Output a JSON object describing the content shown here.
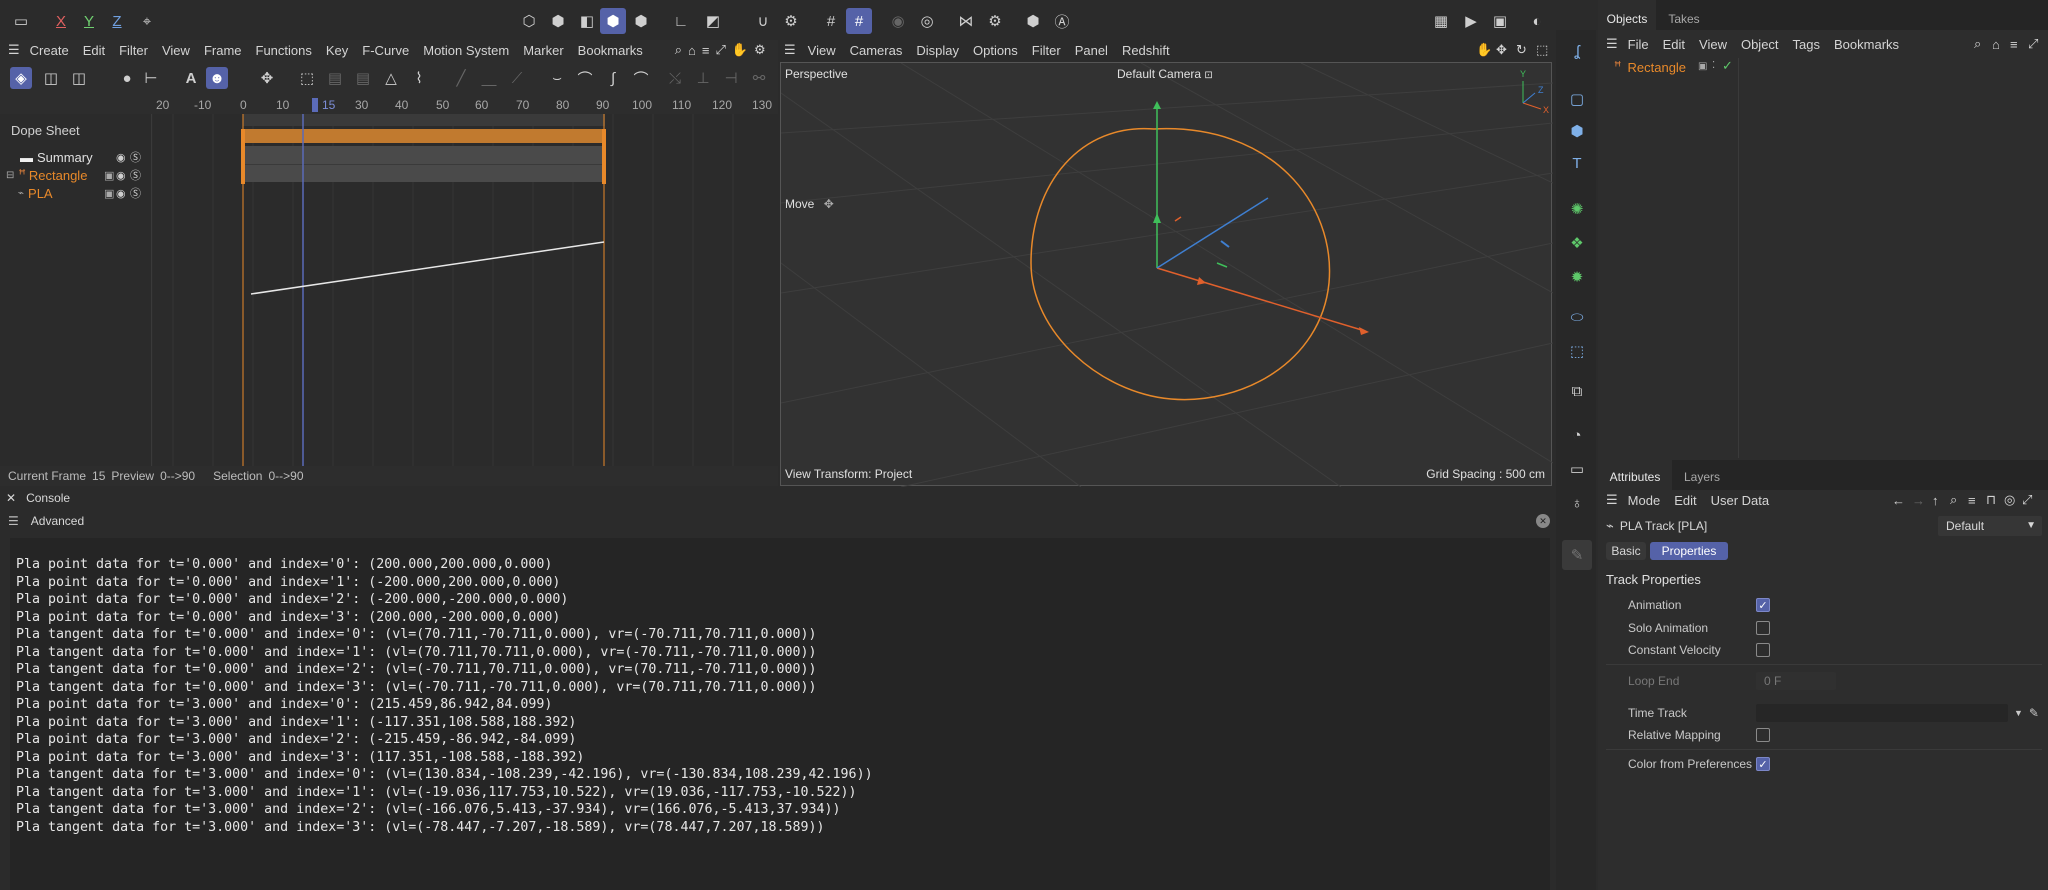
{
  "toolbar": {
    "axis_x": "X",
    "axis_y": "Y",
    "axis_z": "Z"
  },
  "timeline": {
    "menu": [
      "Create",
      "Edit",
      "Filter",
      "View",
      "Frame",
      "Functions",
      "Key",
      "F-Curve",
      "Motion System",
      "Marker",
      "Bookmarks"
    ],
    "ruler": [
      "20",
      "-10",
      "0",
      "10",
      "15",
      "30",
      "40",
      "50",
      "60",
      "70",
      "80",
      "90",
      "100",
      "110",
      "120",
      "130"
    ],
    "panel_title": "Dope Sheet",
    "tracks": [
      {
        "label": "Summary"
      },
      {
        "label": "Rectangle"
      },
      {
        "label": "PLA"
      }
    ],
    "status": {
      "current_frame_label": "Current Frame",
      "current_frame_value": "15",
      "preview_label": "Preview",
      "preview_value": "0-->90",
      "selection_label": "Selection",
      "selection_value": "0-->90"
    }
  },
  "viewport": {
    "menu": [
      "View",
      "Cameras",
      "Display",
      "Options",
      "Filter",
      "Panel",
      "Redshift"
    ],
    "view_name": "Perspective",
    "camera": "Default Camera",
    "tool": "Move",
    "view_transform": "View Transform: Project",
    "grid_spacing": "Grid Spacing : 500 cm",
    "colors": {
      "spline": "#e8892a",
      "axis_x": "#e0602c",
      "axis_y": "#3fbf5a",
      "axis_z": "#3f7fd0"
    }
  },
  "objects_panel": {
    "tabs": [
      "Objects",
      "Takes"
    ],
    "menu": [
      "File",
      "Edit",
      "View",
      "Object",
      "Tags",
      "Bookmarks"
    ],
    "items": [
      {
        "name": "Rectangle"
      }
    ]
  },
  "attributes_panel": {
    "tabs": [
      "Attributes",
      "Layers"
    ],
    "menu": [
      "Mode",
      "Edit",
      "User Data"
    ],
    "title": "PLA Track [PLA]",
    "preset": "Default",
    "subtabs": [
      "Basic",
      "Properties"
    ],
    "section": "Track Properties",
    "props": {
      "animation": {
        "label": "Animation",
        "checked": true
      },
      "solo_animation": {
        "label": "Solo Animation",
        "checked": false
      },
      "constant_velocity": {
        "label": "Constant Velocity",
        "checked": false
      },
      "loop_end": {
        "label": "Loop End",
        "value": "0 F"
      },
      "time_track": {
        "label": "Time Track",
        "value": ""
      },
      "relative_mapping": {
        "label": "Relative Mapping",
        "checked": false
      },
      "color_from_prefs": {
        "label": "Color from Preferences",
        "checked": true
      }
    }
  },
  "console": {
    "title": "Console",
    "subtitle": "Advanced",
    "lines": [
      "Pla point data for t='0.000' and index='0': (200.000,200.000,0.000)",
      "Pla point data for t='0.000' and index='1': (-200.000,200.000,0.000)",
      "Pla point data for t='0.000' and index='2': (-200.000,-200.000,0.000)",
      "Pla point data for t='0.000' and index='3': (200.000,-200.000,0.000)",
      "Pla tangent data for t='0.000' and index='0': (vl=(70.711,-70.711,0.000), vr=(-70.711,70.711,0.000))",
      "Pla tangent data for t='0.000' and index='1': (vl=(70.711,70.711,0.000), vr=(-70.711,-70.711,0.000))",
      "Pla tangent data for t='0.000' and index='2': (vl=(-70.711,70.711,0.000), vr=(70.711,-70.711,0.000))",
      "Pla tangent data for t='0.000' and index='3': (vl=(-70.711,-70.711,0.000), vr=(70.711,70.711,0.000))",
      "Pla point data for t='3.000' and index='0': (215.459,86.942,84.099)",
      "Pla point data for t='3.000' and index='1': (-117.351,108.588,188.392)",
      "Pla point data for t='3.000' and index='2': (-215.459,-86.942,-84.099)",
      "Pla point data for t='3.000' and index='3': (117.351,-108.588,-188.392)",
      "Pla tangent data for t='3.000' and index='0': (vl=(130.834,-108.239,-42.196), vr=(-130.834,108.239,42.196))",
      "Pla tangent data for t='3.000' and index='1': (vl=(-19.036,117.753,10.522), vr=(19.036,-117.753,-10.522))",
      "Pla tangent data for t='3.000' and index='2': (vl=(-166.076,5.413,-37.934), vr=(166.076,-5.413,37.934))",
      "Pla tangent data for t='3.000' and index='3': (vl=(-78.447,-7.207,-18.589), vr=(78.447,7.207,18.589))"
    ]
  }
}
